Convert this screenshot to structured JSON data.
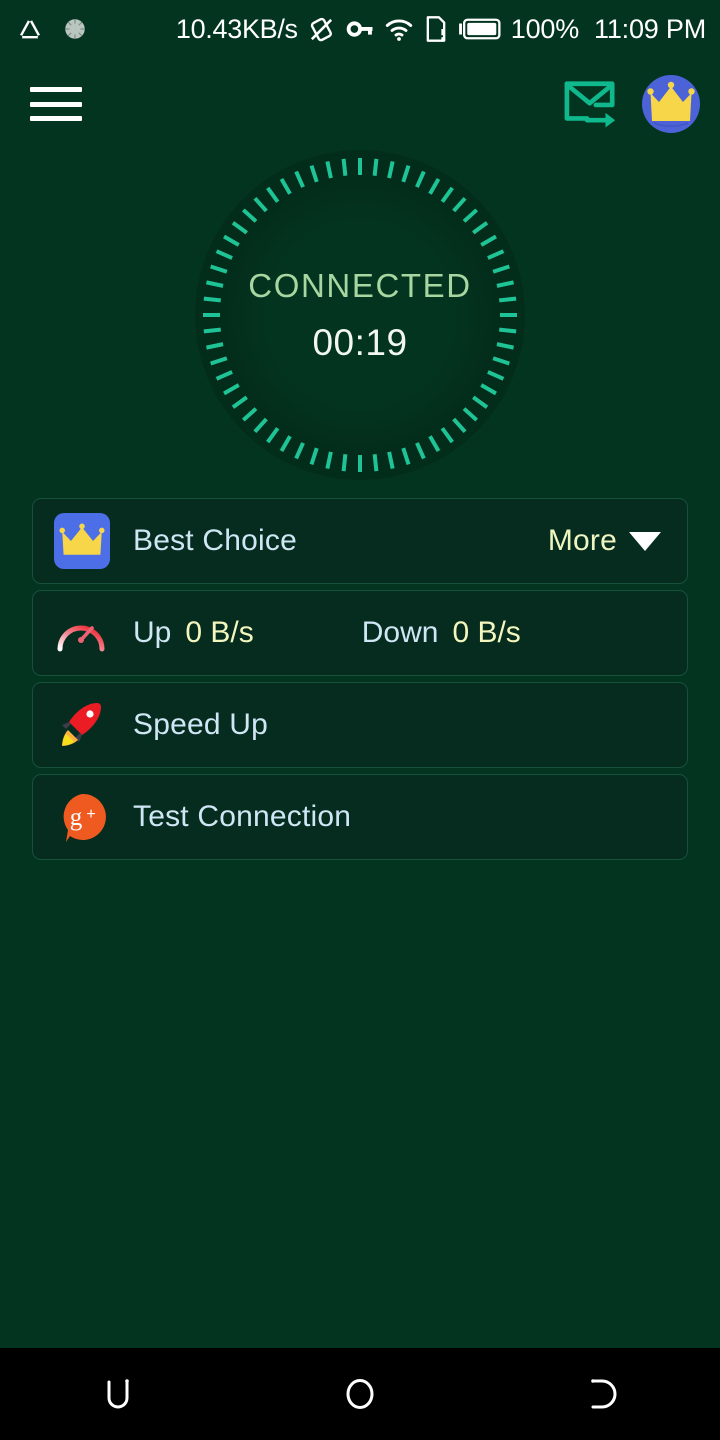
{
  "status_bar": {
    "network_speed": "10.43KB/s",
    "battery_percent": "100%",
    "time": "11:09 PM",
    "icons": [
      "notification-triangle-icon",
      "sync-spinner-icon",
      "rotation-lock-icon",
      "vpn-key-icon",
      "wifi-icon",
      "sim-missing-icon",
      "battery-full-icon"
    ]
  },
  "app_bar": {
    "menu_icon": "hamburger-menu-icon",
    "share_icon": "send-mail-icon",
    "premium_icon": "premium-crown-avatar-icon"
  },
  "dial": {
    "status": "CONNECTED",
    "timer": "00:19",
    "tick_count": 60,
    "tick_color": "#1fc496",
    "status_color": "#a8d6a0",
    "timer_color": "#f2f7f2"
  },
  "cards": [
    {
      "name": "best-choice",
      "icon": "crown-icon",
      "label": "Best Choice",
      "action_label": "More",
      "action_icon": "chevron-down-icon"
    },
    {
      "name": "speed-stats",
      "icon": "speedometer-icon",
      "up_label": "Up",
      "up_value": "0 B/s",
      "down_label": "Down",
      "down_value": "0 B/s"
    },
    {
      "name": "speed-up",
      "icon": "rocket-icon",
      "label": "Speed Up"
    },
    {
      "name": "test-connection",
      "icon": "google-plus-icon",
      "label": "Test Connection"
    }
  ],
  "nav_bar": {
    "back_icon": "back-nav-icon",
    "home_icon": "home-nav-icon",
    "recents_icon": "recents-nav-icon"
  },
  "colors": {
    "background": "#03341F",
    "card_background": "#052C1E",
    "card_border": "#16513c",
    "accent_teal": "#14b592",
    "accent_yellow": "#f7d54a",
    "nav_background": "#000000"
  }
}
